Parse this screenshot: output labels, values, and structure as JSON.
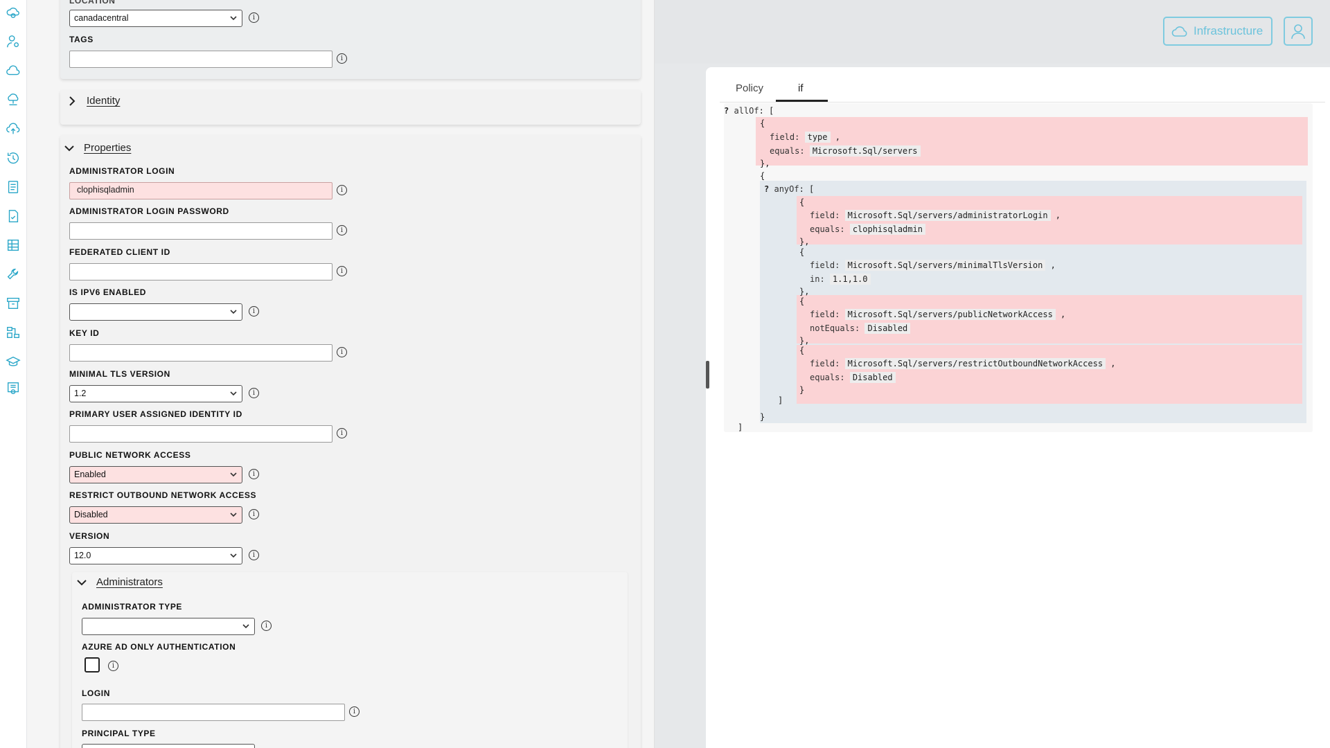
{
  "sidebar": {
    "icons": [
      "cloud-gear-icon",
      "user-settings-icon",
      "cloud-icon",
      "cloud-network-icon",
      "cloud-upload-icon",
      "history-icon",
      "document-list-icon",
      "document-check-icon",
      "table-icon",
      "wrench-icon",
      "archive-icon",
      "workflow-icon",
      "graduation-cap-icon",
      "certificate-icon"
    ]
  },
  "header": {
    "infrastructure_label": "Infrastructure"
  },
  "form": {
    "location_label": "LOCATION",
    "location_value": "canadacentral",
    "tags_label": "TAGS",
    "identity_section": "Identity",
    "properties_section": "Properties",
    "admin_login_label": "ADMINISTRATOR LOGIN",
    "admin_login_value": "clophisqladmin",
    "admin_password_label": "ADMINISTRATOR LOGIN PASSWORD",
    "federated_client_label": "FEDERATED CLIENT ID",
    "ipv6_label": "IS IPV6 ENABLED",
    "ipv6_value": "",
    "key_id_label": "KEY ID",
    "tls_label": "MINIMAL TLS VERSION",
    "tls_value": "1.2",
    "primary_identity_label": "PRIMARY USER ASSIGNED IDENTITY ID",
    "public_access_label": "PUBLIC NETWORK ACCESS",
    "public_access_value": "Enabled",
    "restrict_outbound_label": "RESTRICT OUTBOUND NETWORK ACCESS",
    "restrict_outbound_value": "Disabled",
    "version_label": "VERSION",
    "version_value": "12.0",
    "administrators_section": "Administrators",
    "admin_type_label": "ADMINISTRATOR TYPE",
    "admin_type_value": "",
    "azure_ad_only_label": "AZURE AD ONLY AUTHENTICATION",
    "login_label": "LOGIN",
    "principal_type_label": "PRINCIPAL TYPE",
    "info_glyph": "i"
  },
  "policy": {
    "tabs": [
      "Policy",
      "if"
    ],
    "active_tab": "if",
    "code": {
      "allOf": "allOf",
      "anyOf": "anyOf",
      "q": "?",
      "field_key": "field:",
      "equals_key": "equals:",
      "in_key": "in:",
      "notEquals_key": "notEquals:",
      "type_value": "type",
      "servers_value": "Microsoft.Sql/servers",
      "admin_login_field": "Microsoft.Sql/servers/administratorLogin",
      "admin_login_equals": "clophisqladmin",
      "tls_field": "Microsoft.Sql/servers/minimalTlsVersion",
      "tls_in": "1.1,1.0",
      "public_field": "Microsoft.Sql/servers/publicNetworkAccess",
      "public_notEquals": "Disabled",
      "restrict_field": "Microsoft.Sql/servers/restrictOutboundNetworkAccess",
      "restrict_equals": "Disabled"
    }
  },
  "colors": {
    "accent": "#29a6c8",
    "error_bg": "#fde1e1",
    "highlight_red": "#fbd3d5",
    "highlight_blue": "#e3e9ee"
  }
}
